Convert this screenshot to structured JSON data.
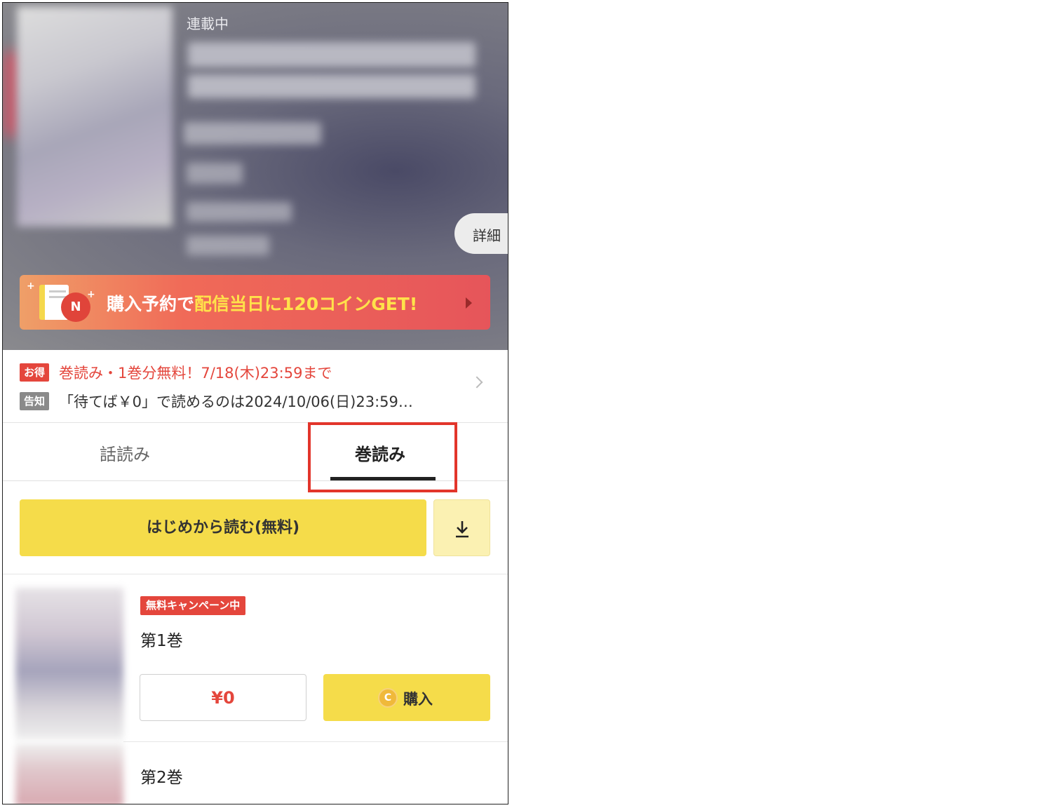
{
  "header": {
    "status": "連載中",
    "detail_button": "詳細",
    "promo": {
      "text_plain": "購入予約で",
      "text_highlight": "配信当日に120コインGET!"
    }
  },
  "notices": [
    {
      "tag": "お得",
      "text": "巻読み・1巻分無料！7/18(木)23:59まで"
    },
    {
      "tag": "告知",
      "text": "「待てば￥0」で読めるのは2024/10/06(日)23:59…"
    }
  ],
  "tabs": [
    {
      "label": "話読み",
      "active": false
    },
    {
      "label": "巻読み",
      "active": true
    }
  ],
  "read_button": "はじめから読む(無料)",
  "volumes": [
    {
      "badge": "無料キャンペーン中",
      "title": "第1巻",
      "price": "¥0",
      "buy_label": "購入"
    },
    {
      "title": "第2巻"
    }
  ],
  "colors": {
    "accent_yellow": "#f5dc4a",
    "accent_red": "#e4463c",
    "highlight_box": "#e2352b"
  },
  "icons": {
    "download": "download-icon",
    "coin": "coin-icon",
    "coin_glyph": "C",
    "promo_badge": "N"
  }
}
